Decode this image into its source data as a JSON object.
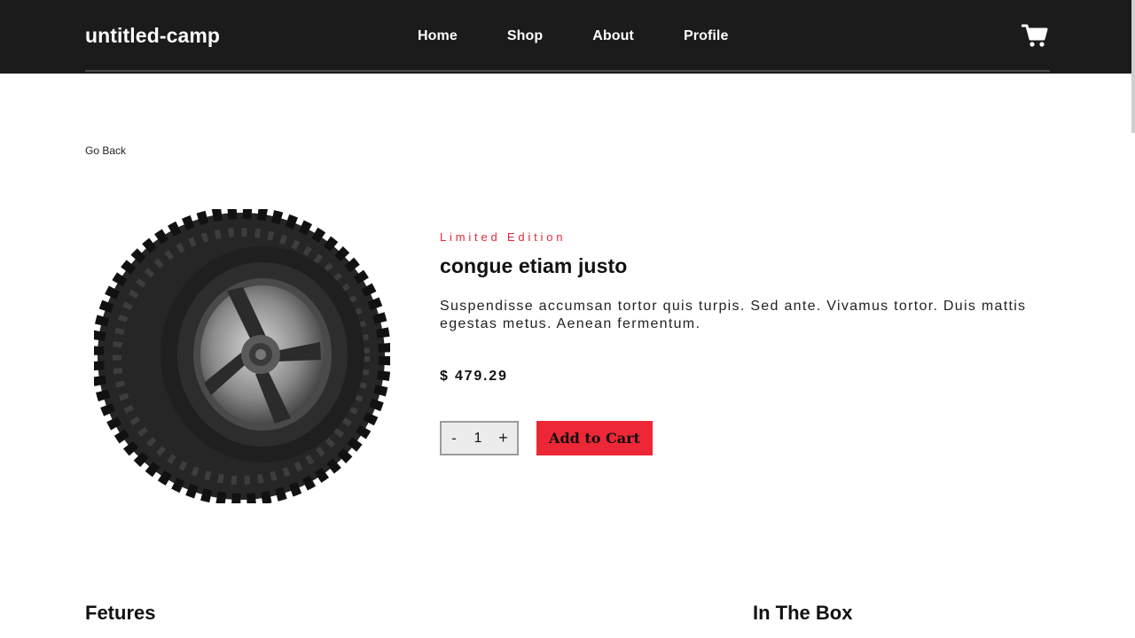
{
  "header": {
    "brand": "untitled-camp",
    "nav": [
      "Home",
      "Shop",
      "About",
      "Profile"
    ],
    "cart_icon": "cart-icon"
  },
  "page": {
    "back_link": "Go Back"
  },
  "product": {
    "image_icon": "tire-image",
    "edition": "Limited Edition",
    "title": "congue etiam justo",
    "description": "Suspendisse accumsan tortor quis turpis. Sed ante. Vivamus tortor. Duis mattis egestas metus. Aenean fermentum.",
    "price": "$ 479.29",
    "quantity": "1",
    "minus_label": "-",
    "plus_label": "+",
    "add_to_cart_label": "Add to Cart"
  },
  "sections": {
    "features_heading": "Fetures",
    "in_the_box_heading": "In The Box"
  },
  "colors": {
    "header_bg": "#1b1b1b",
    "accent": "#ee2737",
    "edition_text": "#e3293a"
  }
}
